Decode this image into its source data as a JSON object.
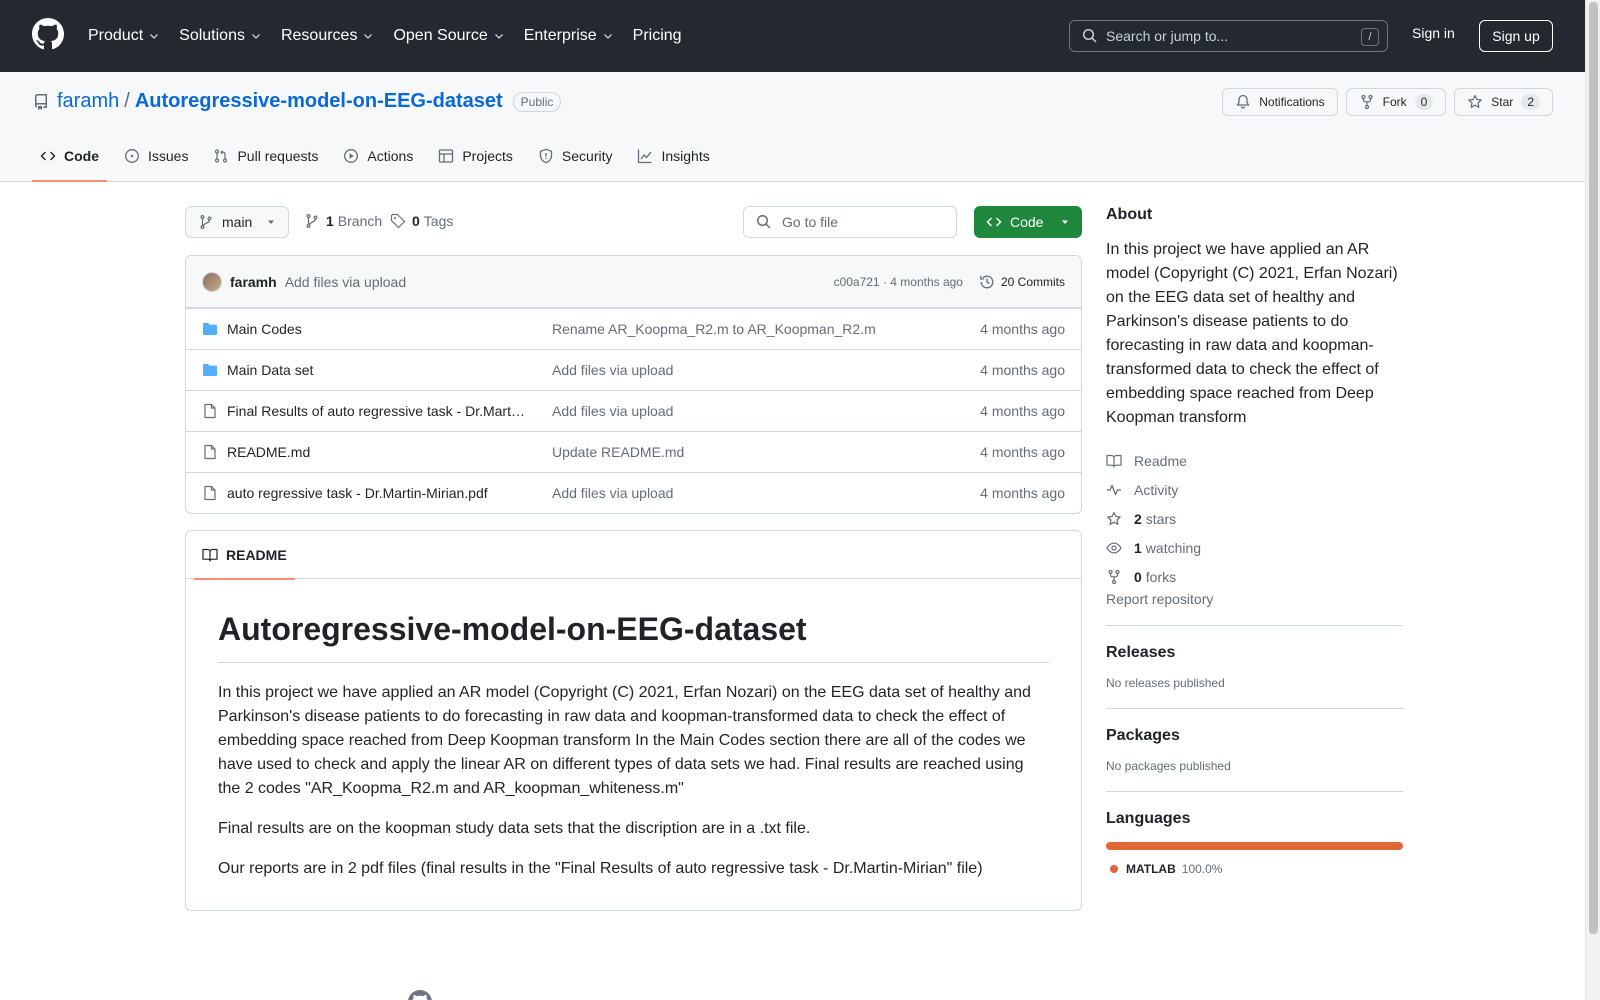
{
  "header": {
    "nav": [
      "Product",
      "Solutions",
      "Resources",
      "Open Source",
      "Enterprise",
      "Pricing"
    ],
    "search_placeholder": "Search or jump to...",
    "search_shortcut": "/",
    "signin": "Sign in",
    "signup": "Sign up"
  },
  "repo": {
    "owner": "faramh",
    "separator": "/",
    "name": "Autoregressive-model-on-EEG-dataset",
    "visibility": "Public",
    "notifications": "Notifications",
    "fork_label": "Fork",
    "fork_count": "0",
    "star_label": "Star",
    "star_count": "2",
    "tabs": [
      "Code",
      "Issues",
      "Pull requests",
      "Actions",
      "Projects",
      "Security",
      "Insights"
    ]
  },
  "toolbar": {
    "branch": "main",
    "branch_count": "1",
    "branch_label": "Branch",
    "tag_count": "0",
    "tag_label": "Tags",
    "goto_placeholder": "Go to file",
    "code_button": "Code"
  },
  "commit": {
    "author": "faramh",
    "message": "Add files via upload",
    "meta": "c00a721 · 4 months ago",
    "commits": "20 Commits"
  },
  "files": [
    {
      "type": "folder",
      "name": "Main Codes",
      "message": "Rename AR_Koopma_R2.m to AR_Koopman_R2.m",
      "date": "4 months ago"
    },
    {
      "type": "folder",
      "name": "Main Data set",
      "message": "Add files via upload",
      "date": "4 months ago"
    },
    {
      "type": "file",
      "name": "Final Results of auto regressive task - Dr.Mart…",
      "message": "Add files via upload",
      "date": "4 months ago"
    },
    {
      "type": "file",
      "name": "README.md",
      "message": "Update README.md",
      "date": "4 months ago"
    },
    {
      "type": "file",
      "name": "auto regressive task - Dr.Martin-Mirian.pdf",
      "message": "Add files via upload",
      "date": "4 months ago"
    }
  ],
  "readme": {
    "tab": "README",
    "title": "Autoregressive-model-on-EEG-dataset",
    "p1": "In this project we have applied an AR model (Copyright (C) 2021, Erfan Nozari) on the EEG data set of healthy and Parkinson's disease patients to do forecasting in raw data and koopman-transformed data to check the effect of embedding space reached from Deep Koopman transform In the Main Codes section there are all of the codes we have used to check and apply the linear AR on different types of data sets we had. Final results are reached using the 2 codes \"AR_Koopma_R2.m and AR_koopman_whiteness.m\"",
    "p2": "Final results are on the koopman study data sets that the discription are in a .txt file.",
    "p3": "Our reports are in 2 pdf files (final results in the \"Final Results of auto regressive task - Dr.Martin-Mirian\" file)"
  },
  "sidebar": {
    "about_title": "About",
    "description": "In this project we have applied an AR model (Copyright (C) 2021, Erfan Nozari) on the EEG data set of healthy and Parkinson's disease patients to do forecasting in raw data and koopman-transformed data to check the effect of embedding space reached from Deep Koopman transform",
    "readme": "Readme",
    "activity": "Activity",
    "stars_count": "2",
    "stars_label": "stars",
    "watching_count": "1",
    "watching_label": "watching",
    "forks_count": "0",
    "forks_label": "forks",
    "report": "Report repository",
    "releases_title": "Releases",
    "releases_empty": "No releases published",
    "packages_title": "Packages",
    "packages_empty": "No packages published",
    "languages_title": "Languages",
    "language_name": "MATLAB",
    "language_pct": "100.0%",
    "language_color": "#e16737"
  },
  "colors": {
    "header_bg": "#24292f",
    "link": "#0969da",
    "code_button": "#1f883d",
    "active_tab_underline": "#fd8c73"
  }
}
